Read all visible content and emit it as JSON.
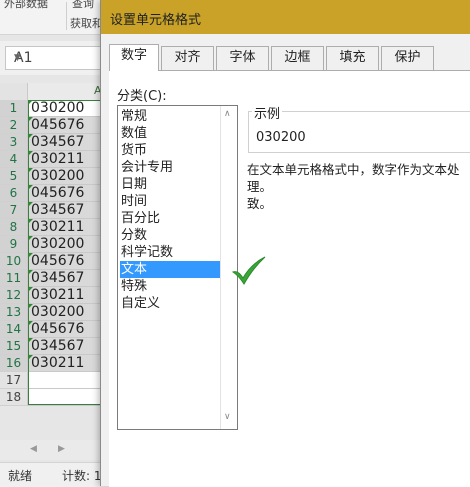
{
  "ribbon": {
    "group1": "外部数据",
    "group2": "查询",
    "group3": "获取和"
  },
  "namebox": {
    "value": "A1"
  },
  "sheet": {
    "column_header": "A",
    "rows": [
      {
        "n": "1",
        "v": "030200"
      },
      {
        "n": "2",
        "v": "045676"
      },
      {
        "n": "3",
        "v": "034567"
      },
      {
        "n": "4",
        "v": "030211"
      },
      {
        "n": "5",
        "v": "030200"
      },
      {
        "n": "6",
        "v": "045676"
      },
      {
        "n": "7",
        "v": "034567"
      },
      {
        "n": "8",
        "v": "030211"
      },
      {
        "n": "9",
        "v": "030200"
      },
      {
        "n": "10",
        "v": "045676"
      },
      {
        "n": "11",
        "v": "034567"
      },
      {
        "n": "12",
        "v": "030211"
      },
      {
        "n": "13",
        "v": "030200"
      },
      {
        "n": "14",
        "v": "045676"
      },
      {
        "n": "15",
        "v": "034567"
      },
      {
        "n": "16",
        "v": "030211"
      },
      {
        "n": "17",
        "v": ""
      },
      {
        "n": "18",
        "v": ""
      }
    ]
  },
  "status": {
    "ready": "就绪",
    "count": "计数: 1"
  },
  "dialog": {
    "title": "设置单元格格式",
    "tabs": [
      "数字",
      "对齐",
      "字体",
      "边框",
      "填充",
      "保护"
    ],
    "active_tab": "数字",
    "category_label": "分类(C):",
    "categories": [
      "常规",
      "数值",
      "货币",
      "会计专用",
      "日期",
      "时间",
      "百分比",
      "分数",
      "科学记数",
      "文本",
      "特殊",
      "自定义"
    ],
    "selected_category": "文本",
    "sample_label": "示例",
    "sample_value": "030200",
    "description": "在文本单元格格式中，数字作为文本处理。单元格显示的内容与输入的内容完全一致。",
    "description_visible_line1": "在文本单元格格式中，数字作为文本处理。",
    "description_visible_line2": "致。"
  },
  "colors": {
    "titlebar": "#c9a227",
    "selection": "#3399ff",
    "checkmark": "#3aa63a",
    "excel_green": "#217346"
  },
  "icons": {
    "checkmark": "check-icon"
  }
}
